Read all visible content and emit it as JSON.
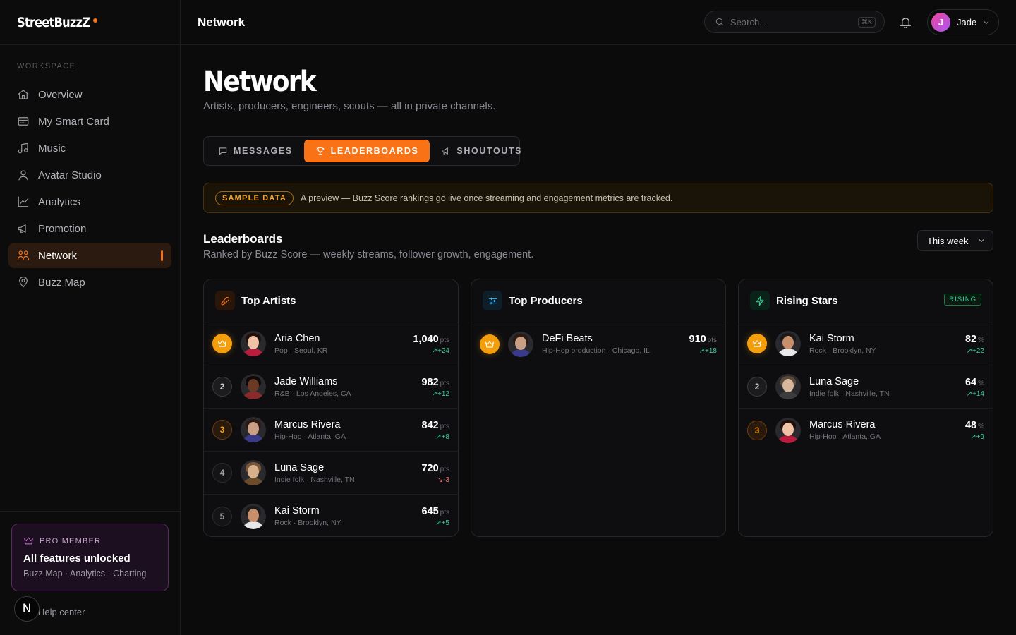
{
  "brand": {
    "name": "StreetBuzzZ"
  },
  "sidebar": {
    "section_label": "WORKSPACE",
    "items": [
      {
        "label": "Overview",
        "icon": "home-icon"
      },
      {
        "label": "My Smart Card",
        "icon": "card-icon"
      },
      {
        "label": "Music",
        "icon": "music-note-icon"
      },
      {
        "label": "Avatar Studio",
        "icon": "user-icon"
      },
      {
        "label": "Analytics",
        "icon": "line-chart-icon"
      },
      {
        "label": "Promotion",
        "icon": "megaphone-icon"
      },
      {
        "label": "Network",
        "icon": "network-icon",
        "active": true
      },
      {
        "label": "Buzz Map",
        "icon": "map-pin-icon"
      }
    ],
    "pro": {
      "badge": "PRO MEMBER",
      "title": "All features unlocked",
      "subtitle": "Buzz Map · Analytics · Charting"
    },
    "help": "Help center",
    "n_badge": "N"
  },
  "topbar": {
    "title": "Network",
    "search_placeholder": "Search...",
    "search_shortcut": "⌘K",
    "user": {
      "initial": "J",
      "name": "Jade"
    }
  },
  "page": {
    "title": "Network",
    "subtitle": "Artists, producers, engineers, scouts — all in private channels.",
    "tabs": [
      {
        "label": "MESSAGES",
        "icon": "message-icon"
      },
      {
        "label": "LEADERBOARDS",
        "icon": "trophy-icon",
        "active": true
      },
      {
        "label": "SHOUTOUTS",
        "icon": "megaphone-icon"
      }
    ],
    "notice": {
      "badge": "SAMPLE DATA",
      "text": "A preview — Buzz Score rankings go live once streaming and engagement metrics are tracked."
    },
    "section": {
      "title": "Leaderboards",
      "subtitle": "Ranked by Buzz Score — weekly streams, follower growth, engagement.",
      "period": "This week"
    }
  },
  "colors": {
    "accent": "#f97316",
    "gold": "#f59e0b",
    "up": "#34d399",
    "down": "#f87171"
  },
  "boards": [
    {
      "title": "Top Artists",
      "unit": "pts",
      "rows": [
        {
          "rank": "1",
          "name": "Aria Chen",
          "meta": "Pop · Seoul, KR",
          "score": "1,040",
          "delta": "+24",
          "trend": "up"
        },
        {
          "rank": "2",
          "name": "Jade Williams",
          "meta": "R&B · Los Angeles, CA",
          "score": "982",
          "delta": "+12",
          "trend": "up"
        },
        {
          "rank": "3",
          "name": "Marcus Rivera",
          "meta": "Hip-Hop · Atlanta, GA",
          "score": "842",
          "delta": "+8",
          "trend": "up"
        },
        {
          "rank": "4",
          "name": "Luna Sage",
          "meta": "Indie folk · Nashville, TN",
          "score": "720",
          "delta": "-3",
          "trend": "down"
        },
        {
          "rank": "5",
          "name": "Kai Storm",
          "meta": "Rock · Brooklyn, NY",
          "score": "645",
          "delta": "+5",
          "trend": "up"
        }
      ]
    },
    {
      "title": "Top Producers",
      "unit": "pts",
      "rows": [
        {
          "rank": "1",
          "name": "DeFi Beats",
          "meta": "Hip-Hop production · Chicago, IL",
          "score": "910",
          "delta": "+18",
          "trend": "up"
        }
      ]
    },
    {
      "title": "Rising Stars",
      "tag": "RISING",
      "unit": "%",
      "rows": [
        {
          "rank": "1",
          "name": "Kai Storm",
          "meta": "Rock · Brooklyn, NY",
          "score": "82",
          "delta": "+22",
          "trend": "up"
        },
        {
          "rank": "2",
          "name": "Luna Sage",
          "meta": "Indie folk · Nashville, TN",
          "score": "64",
          "delta": "+14",
          "trend": "up"
        },
        {
          "rank": "3",
          "name": "Marcus Rivera",
          "meta": "Hip-Hop · Atlanta, GA",
          "score": "48",
          "delta": "+9",
          "trend": "up"
        }
      ]
    }
  ]
}
